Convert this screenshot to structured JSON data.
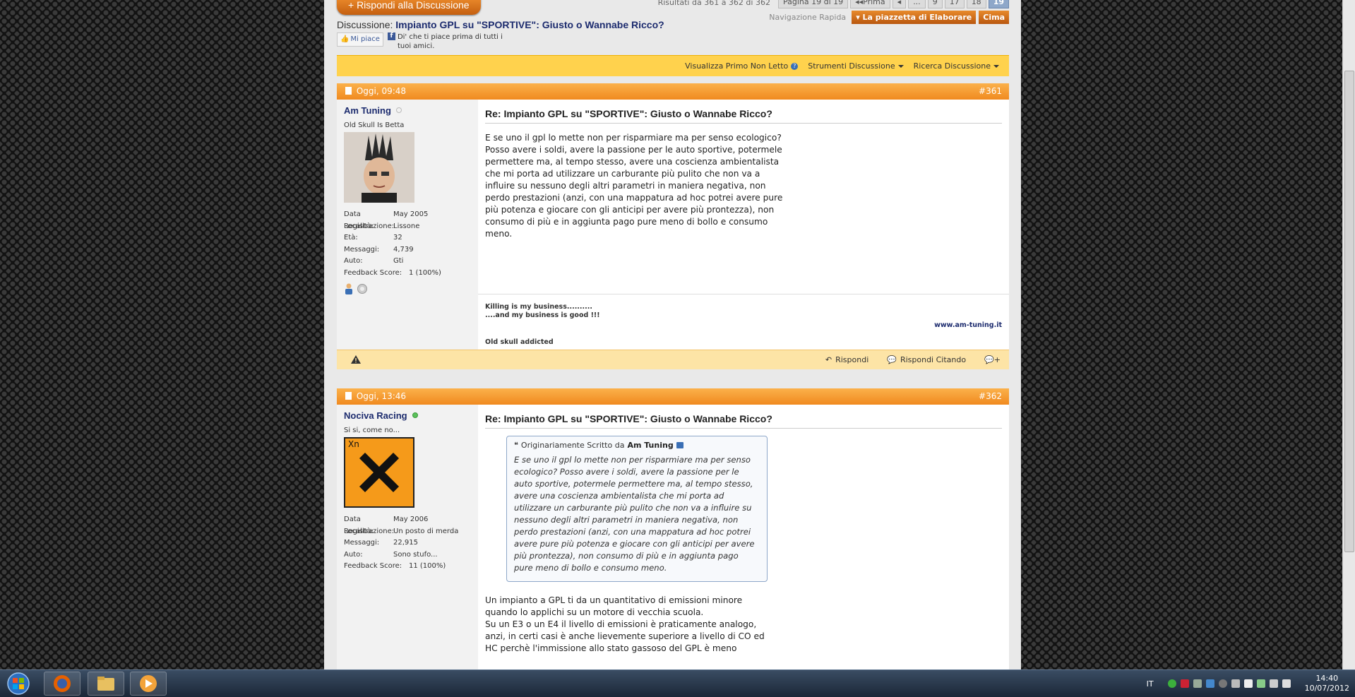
{
  "thread": {
    "reply_button": "+ Rispondi alla Discussione",
    "results_text": "Risultati da 361 a 362 di 362",
    "pager": [
      "Pagina 19 di 19",
      "◂◂Prima",
      "◂",
      "...",
      "9",
      "17",
      "18",
      "19"
    ],
    "quicknav_label": "Navigazione Rapida",
    "forum_tab": "La piazzetta di Elaborare",
    "top_tab": "Cima",
    "title_prefix": "Discussione:",
    "title": "Impianto GPL su \"SPORTIVE\": Giusto o Wannabe Ricco?",
    "like_label": "Mi piace",
    "fb_text": "Di' che ti piace prima di tutti i tuoi amici."
  },
  "toolbar": {
    "first_unread": "Visualizza Primo Non Letto",
    "tools": "Strumenti Discussione",
    "search": "Ricerca Discussione"
  },
  "labels": {
    "reg": "Data Registrazione:",
    "loc": "Località:",
    "age": "Età:",
    "posts": "Messaggi:",
    "car": "Auto:",
    "feedback": "Feedback Score:",
    "reply": "Rispondi",
    "quote_reply": "Rispondi Citando"
  },
  "posts": [
    {
      "date": "Oggi, 09:48",
      "number": "#361",
      "username": "Am Tuning",
      "user_title": "Old Skull Is Betta",
      "reg": "May 2005",
      "loc": "Lissone",
      "age": "32",
      "posts": "4,739",
      "car": "Gti",
      "feedback": "1 (100%)",
      "title": "Re: Impianto GPL su \"SPORTIVE\": Giusto o Wannabe Ricco?",
      "text": "E se uno il gpl lo mette non per risparmiare ma per senso ecologico? Posso avere i soldi, avere la passione per le auto sportive, potermele permettere ma, al tempo stesso, avere una coscienza ambientalista che mi porta ad utilizzare un carburante più pulito che non va a influire su nessuno degli altri parametri in maniera negativa, non perdo prestazioni (anzi, con una mappatura ad hoc potrei avere pure più potenza e giocare con gli anticipi per avere più prontezza), non consumo di più e in aggiunta pago pure meno di bollo e consumo meno.",
      "sig1": "Killing is my business..........",
      "sig2": "....and my business is good !!!",
      "sig_url": "www.am-tuning.it",
      "sig3": "Old skull addicted"
    },
    {
      "date": "Oggi, 13:46",
      "number": "#362",
      "username": "Nociva Racing",
      "user_title": "Si si, come no...",
      "avatar_text": "Xn",
      "reg": "May 2006",
      "loc": "Un posto di merda",
      "posts": "22,915",
      "car": "Sono stufo...",
      "feedback": "11 (100%)",
      "title": "Re: Impianto GPL su \"SPORTIVE\": Giusto o Wannabe Ricco?",
      "quote_prefix": "Originariamente Scritto da",
      "quote_author": "Am Tuning",
      "quote_text": "E se uno il gpl lo mette non per risparmiare ma per senso ecologico? Posso avere i soldi, avere la passione per le auto sportive, potermele permettere ma, al tempo stesso, avere una coscienza ambientalista che mi porta ad utilizzare un carburante più pulito che non va a influire su nessuno degli altri parametri in maniera negativa, non perdo prestazioni (anzi, con una mappatura ad hoc potrei avere pure più potenza e giocare con gli anticipi per avere più prontezza), non consumo di più e in aggiunta pago pure meno di bollo e consumo meno.",
      "text_lines": [
        "Un impianto a GPL ti da un quantitativo di emissioni minore",
        "quando lo applichi su un motore di vecchia scuola.",
        "Su un E3 o un E4 il livello di emissioni è praticamente analogo,",
        "anzi, in certi casi è anche lievemente superiore a livello di CO ed",
        "HC perchè l'immissione allo stato gassoso del GPL è meno"
      ]
    }
  ],
  "taskbar": {
    "lang": "IT",
    "time": "14:40",
    "date": "10/07/2012"
  },
  "colors": {
    "post_header": "#f08a1f",
    "toolbar": "#ffd24d",
    "username": "#1c2b6e",
    "taskbar": "#1b2737"
  }
}
